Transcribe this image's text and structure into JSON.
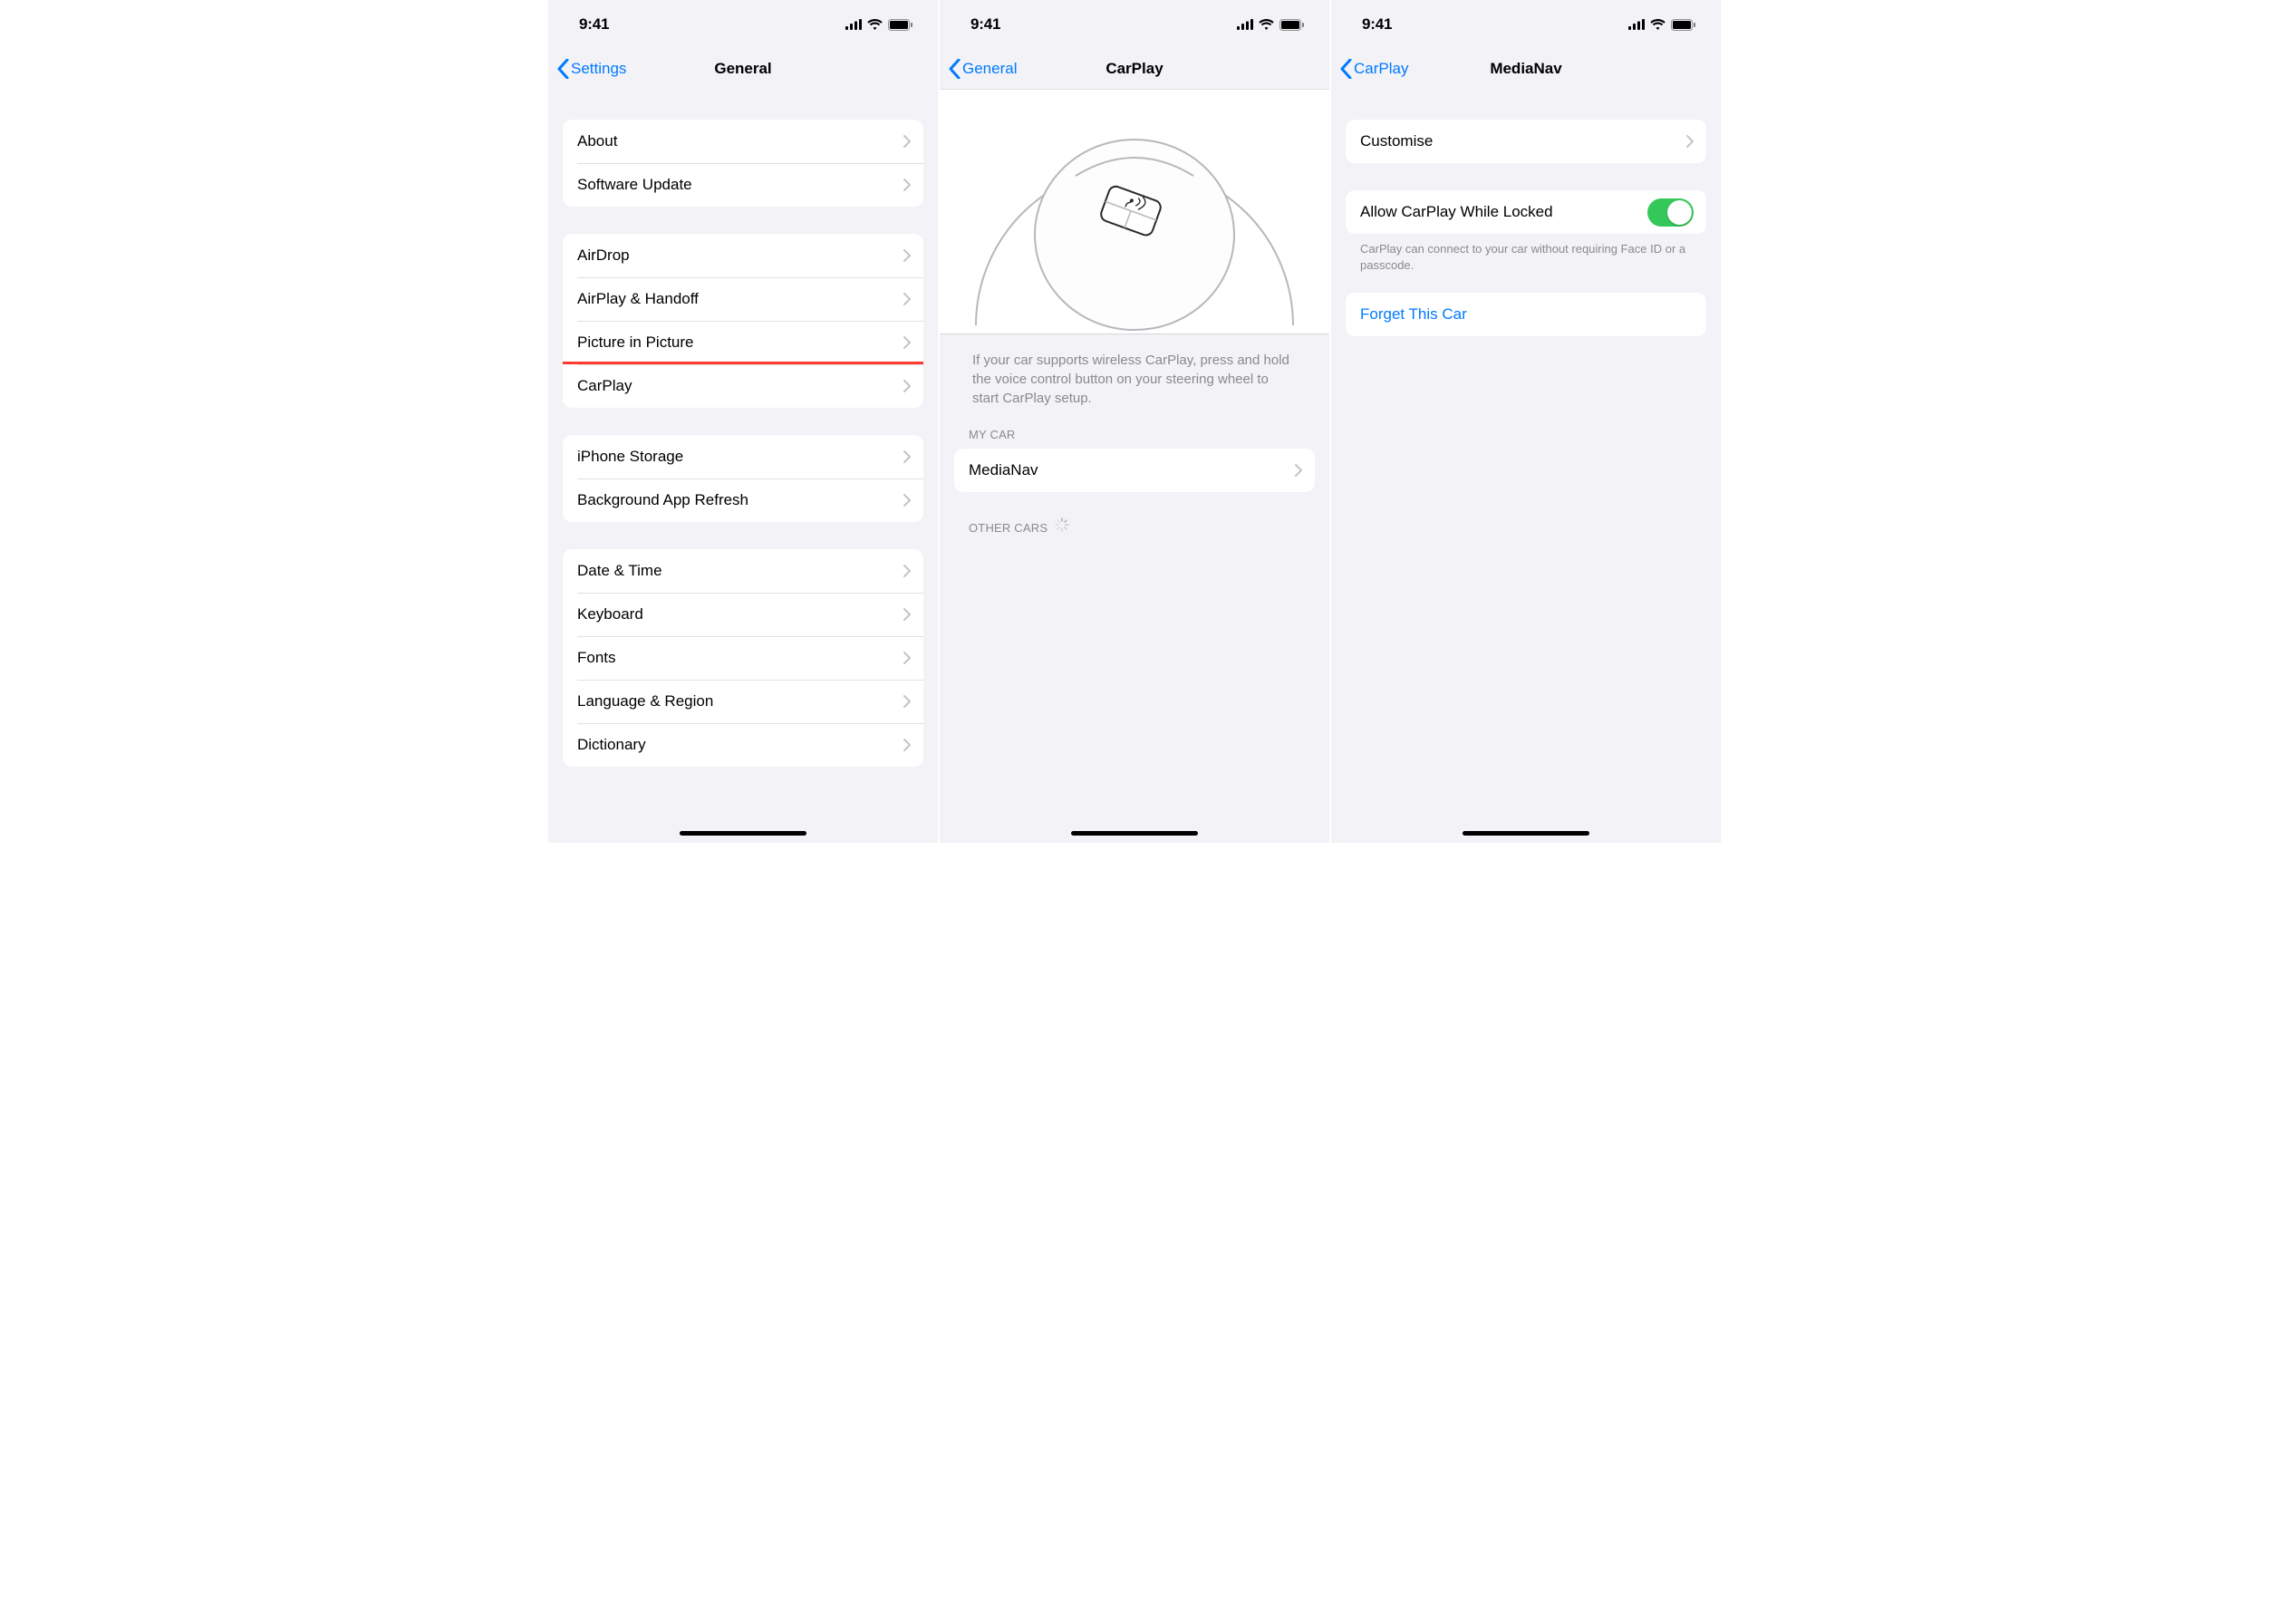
{
  "status": {
    "time": "9:41"
  },
  "screen1": {
    "back": "Settings",
    "title": "General",
    "groups": [
      [
        "About",
        "Software Update"
      ],
      [
        "AirDrop",
        "AirPlay & Handoff",
        "Picture in Picture",
        "CarPlay"
      ],
      [
        "iPhone Storage",
        "Background App Refresh"
      ],
      [
        "Date & Time",
        "Keyboard",
        "Fonts",
        "Language & Region",
        "Dictionary"
      ]
    ],
    "highlight_target": "CarPlay"
  },
  "screen2": {
    "back": "General",
    "title": "CarPlay",
    "instruction": "If your car supports wireless CarPlay, press and hold the voice control button on your steering wheel to start CarPlay setup.",
    "header1": "MY CAR",
    "car_row": "MediaNav",
    "header2": "OTHER CARS",
    "highlight_target": "MediaNav"
  },
  "screen3": {
    "back": "CarPlay",
    "title": "MediaNav",
    "row_customise": "Customise",
    "row_allow": "Allow CarPlay While Locked",
    "allow_footer": "CarPlay can connect to your car without requiring Face ID or a passcode.",
    "row_forget": "Forget This Car",
    "allow_on": true,
    "highlight_target": "Forget This Car"
  }
}
